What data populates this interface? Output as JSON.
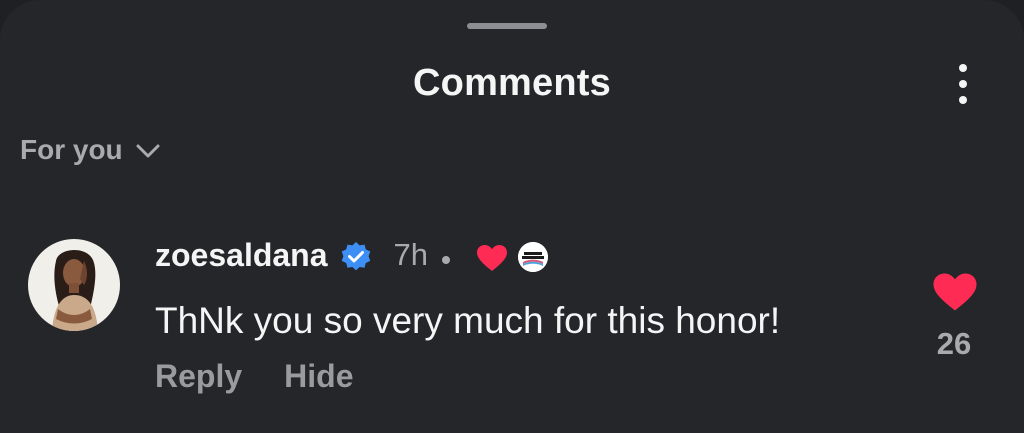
{
  "header": {
    "title": "Comments",
    "more_icon": "more-vertical-icon"
  },
  "filter": {
    "label": "For you",
    "icon": "chevron-down-icon"
  },
  "comment": {
    "username": "zoesaldana",
    "verified": true,
    "time": "7h",
    "liked_by_creator": true,
    "text": "ThNk you so very much for this honor!",
    "reply_label": "Reply",
    "hide_label": "Hide",
    "likes": "26",
    "liked": true
  },
  "colors": {
    "background": "#25262a",
    "text_primary": "#f5f5f5",
    "text_secondary": "#a9aaad",
    "heart": "#fe2c55",
    "verified": "#3d8ff5"
  }
}
